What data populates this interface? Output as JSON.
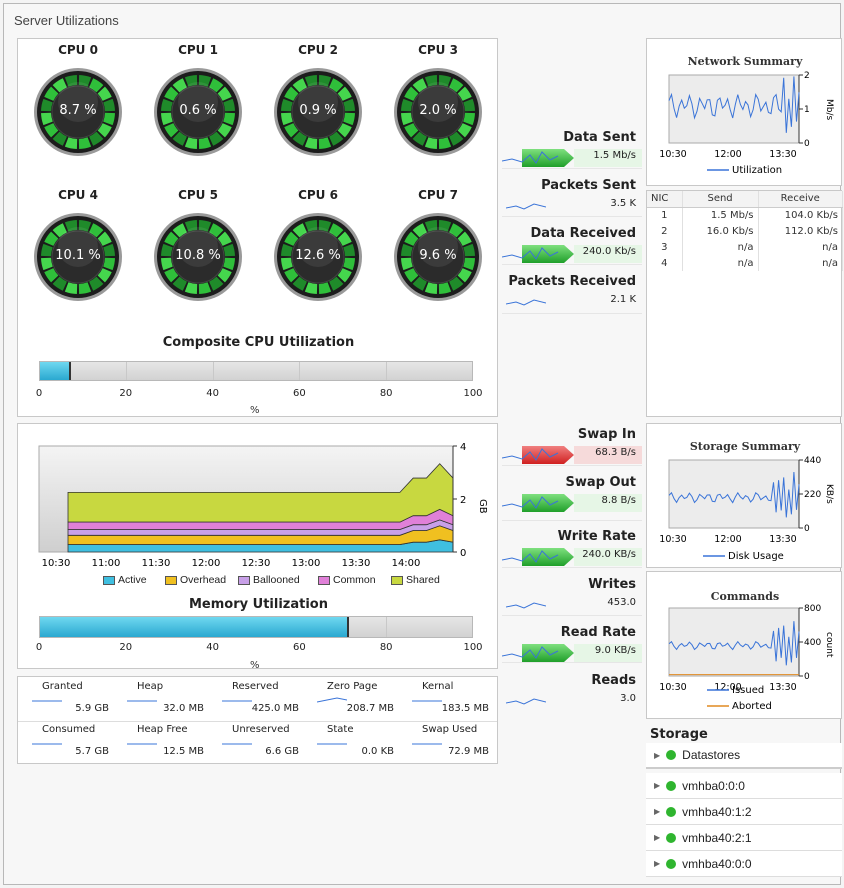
{
  "window": {
    "title": "Server Utilizations"
  },
  "cpus": [
    {
      "label": "CPU 0",
      "value": "8.7 %",
      "pct": 8.7
    },
    {
      "label": "CPU 1",
      "value": "0.6 %",
      "pct": 0.6
    },
    {
      "label": "CPU 2",
      "value": "0.9 %",
      "pct": 0.9
    },
    {
      "label": "CPU 3",
      "value": "2.0 %",
      "pct": 2.0
    },
    {
      "label": "CPU 4",
      "value": "10.1 %",
      "pct": 10.1
    },
    {
      "label": "CPU 5",
      "value": "10.8 %",
      "pct": 10.8
    },
    {
      "label": "CPU 6",
      "value": "12.6 %",
      "pct": 12.6
    },
    {
      "label": "CPU 7",
      "value": "9.6 %",
      "pct": 9.6
    }
  ],
  "composite": {
    "title": "Composite CPU Utilization",
    "value_pct": 7.2,
    "ticks": [
      "0",
      "20",
      "40",
      "60",
      "80",
      "100"
    ],
    "unit": "%"
  },
  "memory_chart": {
    "x_ticks": [
      "10:30",
      "11:00",
      "11:30",
      "12:00",
      "12:30",
      "13:00",
      "13:30",
      "14:00"
    ],
    "y_ticks": [
      "4",
      "2",
      "0"
    ],
    "y_unit": "GB",
    "legend": [
      "Active",
      "Overhead",
      "Ballooned",
      "Common",
      "Shared"
    ],
    "colors": [
      "#3fbfe0",
      "#f0c020",
      "#c8a0e8",
      "#e080d8",
      "#c8d840"
    ]
  },
  "memory_util": {
    "title": "Memory Utilization",
    "value_pct": 71.5,
    "ticks": [
      "0",
      "20",
      "40",
      "60",
      "80",
      "100"
    ],
    "unit": "%"
  },
  "memory_stats": [
    {
      "label": "Granted",
      "value": "5.9 GB"
    },
    {
      "label": "Heap",
      "value": "32.0 MB"
    },
    {
      "label": "Reserved",
      "value": "425.0 MB"
    },
    {
      "label": "Zero Page",
      "value": "208.7 MB"
    },
    {
      "label": "Kernal",
      "value": "183.5 MB"
    },
    {
      "label": "Consumed",
      "value": "5.7 GB"
    },
    {
      "label": "Heap Free",
      "value": "12.5 MB"
    },
    {
      "label": "Unreserved",
      "value": "6.6 GB"
    },
    {
      "label": "State",
      "value": "0.0 KB"
    },
    {
      "label": "Swap Used",
      "value": "72.9 MB"
    }
  ],
  "network_metrics": [
    {
      "label": "Data Sent",
      "value": "1.5 Mb/s"
    },
    {
      "label": "Packets Sent",
      "value": "3.5 K"
    },
    {
      "label": "Data Received",
      "value": "240.0 Kb/s"
    },
    {
      "label": "Packets Received",
      "value": "2.1 K"
    }
  ],
  "storage_metrics": [
    {
      "label": "Swap In",
      "value": "68.3 B/s"
    },
    {
      "label": "Swap Out",
      "value": "8.8 B/s"
    },
    {
      "label": "Write Rate",
      "value": "240.0 KB/s"
    },
    {
      "label": "Writes",
      "value": "453.0"
    },
    {
      "label": "Read Rate",
      "value": "9.0 KB/s"
    },
    {
      "label": "Reads",
      "value": "3.0"
    }
  ],
  "network_summary": {
    "title": "Network Summary",
    "x_ticks": [
      "10:30",
      "12:00",
      "13:30"
    ],
    "y_ticks": [
      "2",
      "1",
      "0"
    ],
    "y_unit": "Mb/s",
    "legend": "Utilization"
  },
  "nic_table": {
    "headers": [
      "NIC",
      "Send",
      "Receive"
    ],
    "rows": [
      [
        "1",
        "1.5 Mb/s",
        "104.0 Kb/s"
      ],
      [
        "2",
        "16.0 Kb/s",
        "112.0 Kb/s"
      ],
      [
        "3",
        "n/a",
        "n/a"
      ],
      [
        "4",
        "n/a",
        "n/a"
      ]
    ]
  },
  "storage_summary": {
    "title": "Storage Summary",
    "x_ticks": [
      "10:30",
      "12:00",
      "13:30"
    ],
    "y_ticks": [
      "440",
      "220",
      "0"
    ],
    "y_unit": "KB/s",
    "legend": "Disk Usage"
  },
  "commands": {
    "title": "Commands",
    "x_ticks": [
      "10:30",
      "12:00",
      "13:30"
    ],
    "y_ticks": [
      "800",
      "400",
      "0"
    ],
    "y_unit": "count",
    "legend": [
      "Issued",
      "Aborted"
    ]
  },
  "storage_tree": {
    "title": "Storage",
    "items": [
      "Datastores",
      "vmhba0:0:0",
      "vmhba40:1:2",
      "vmhba40:2:1",
      "vmhba40:0:0"
    ]
  }
}
